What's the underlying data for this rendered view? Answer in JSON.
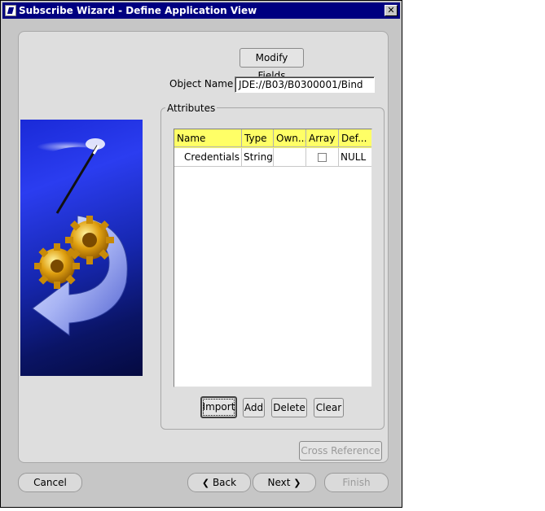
{
  "window": {
    "title": "Subscribe Wizard  - Define Application View",
    "close_glyph": "✕"
  },
  "form": {
    "modify_fields_label": "Modify Fields",
    "object_name_label": "Object Name",
    "object_name_value": "JDE://B03/B0300001/Bind"
  },
  "attributes": {
    "group_title": "Attributes",
    "columns": [
      "Name",
      "Type",
      "Own...",
      "Array",
      "Def..."
    ],
    "rows": [
      {
        "name": "Credentials",
        "type": "String",
        "owner": "",
        "array": false,
        "default": "NULL"
      }
    ],
    "buttons": {
      "import": "Import",
      "add": "Add",
      "delete": "Delete",
      "clear": "Clear"
    }
  },
  "cross_reference_label": "Cross Reference",
  "footer": {
    "cancel": "Cancel",
    "back": "Back",
    "next": "Next",
    "finish": "Finish",
    "back_icon": "chevron-left-icon",
    "next_icon": "chevron-right-icon"
  },
  "graphic": {
    "icon": "wizard-gears-arrow-icon"
  },
  "colors": {
    "title_bar": "#000080",
    "table_header": "#ffff66",
    "graphic_blue": "#1f2fd0"
  }
}
